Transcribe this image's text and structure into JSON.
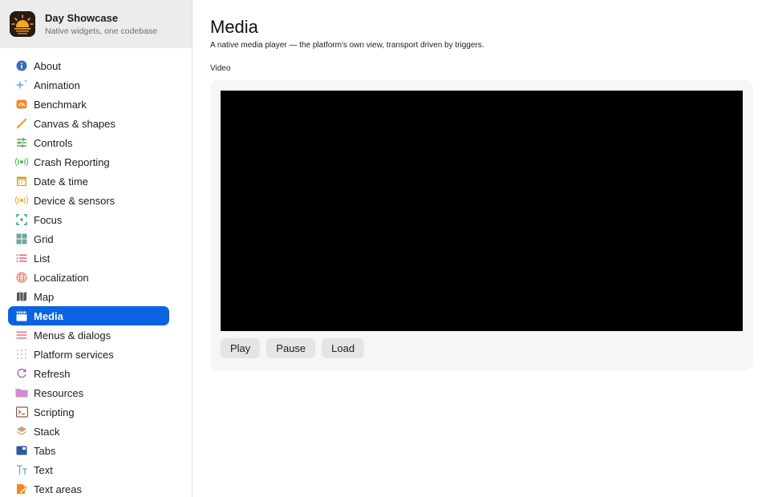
{
  "app": {
    "name": "Day Showcase",
    "subtitle": "Native widgets, one codebase"
  },
  "sidebar": {
    "items": [
      {
        "label": "About",
        "icon": "info-icon",
        "color": "#3b6db5"
      },
      {
        "label": "Animation",
        "icon": "sparkles-icon",
        "color": "#7fb3e8"
      },
      {
        "label": "Benchmark",
        "icon": "speedometer-icon",
        "color": "#f08a24"
      },
      {
        "label": "Canvas & shapes",
        "icon": "brush-icon",
        "color": "#f2a23a"
      },
      {
        "label": "Controls",
        "icon": "sliders-icon",
        "color": "#4a9a4a"
      },
      {
        "label": "Crash Reporting",
        "icon": "broadcast-icon",
        "color": "#5ab55a"
      },
      {
        "label": "Date & time",
        "icon": "calendar-icon",
        "color": "#c9a227"
      },
      {
        "label": "Device & sensors",
        "icon": "sensor-icon",
        "color": "#e0b43a"
      },
      {
        "label": "Focus",
        "icon": "focus-icon",
        "color": "#2f9a8a"
      },
      {
        "label": "Grid",
        "icon": "grid-icon",
        "color": "#6aa8a0"
      },
      {
        "label": "List",
        "icon": "list-icon",
        "color": "#e05a6a"
      },
      {
        "label": "Localization",
        "icon": "globe-icon",
        "color": "#e8836a"
      },
      {
        "label": "Map",
        "icon": "map-icon",
        "color": "#555555"
      },
      {
        "label": "Media",
        "icon": "clapperboard-icon",
        "color": "#ffffff",
        "selected": true
      },
      {
        "label": "Menus & dialogs",
        "icon": "menu-icon",
        "color": "#e06a8a"
      },
      {
        "label": "Platform services",
        "icon": "dots-grid-icon",
        "color": "#e08aa0"
      },
      {
        "label": "Refresh",
        "icon": "refresh-icon",
        "color": "#a05ab5"
      },
      {
        "label": "Resources",
        "icon": "folder-icon",
        "color": "#d48ad0"
      },
      {
        "label": "Scripting",
        "icon": "terminal-icon",
        "color": "#8a5a4a"
      },
      {
        "label": "Stack",
        "icon": "stack-icon",
        "color": "#c8a080"
      },
      {
        "label": "Tabs",
        "icon": "tabs-icon",
        "color": "#2a5aa0"
      },
      {
        "label": "Text",
        "icon": "text-icon",
        "color": "#6aa0c8"
      },
      {
        "label": "Text areas",
        "icon": "document-edit-icon",
        "color": "#f08a24"
      }
    ]
  },
  "main": {
    "title": "Media",
    "description": "A native media player — the platform's own view, transport driven by triggers.",
    "section_label": "Video",
    "buttons": {
      "play": "Play",
      "pause": "Pause",
      "load": "Load"
    }
  },
  "colors": {
    "accent": "#0a63e0",
    "video_background": "#000000",
    "card_background": "#f6f6f6"
  }
}
